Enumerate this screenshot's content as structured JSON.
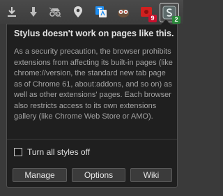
{
  "toolbar": {
    "icons": [
      {
        "name": "download-icon"
      },
      {
        "name": "download-arrow-icon"
      },
      {
        "name": "incognito-icon"
      },
      {
        "name": "map-pin-icon"
      },
      {
        "name": "translate-icon"
      },
      {
        "name": "owl-extension-icon"
      },
      {
        "name": "red-extension-icon",
        "badge": "9",
        "badge_color": "#c8102e"
      },
      {
        "name": "stylus-icon",
        "badge": "2",
        "badge_color": "#2a8a3a"
      }
    ]
  },
  "popup": {
    "title": "Stylus doesn't work on pages like this.",
    "body": "As a security precaution, the browser prohibits extensions from affecting its built-in pages (like chrome://version, the standard new tab page as of Chrome 61, about:addons, and so on) as well as other extensions' pages. Each browser also restricts access to its own extensions gallery (like Chrome Web Store or AMO).",
    "toggle_label": "Turn all styles off",
    "toggle_checked": false,
    "buttons": {
      "manage": "Manage",
      "options": "Options",
      "wiki": "Wiki"
    }
  }
}
